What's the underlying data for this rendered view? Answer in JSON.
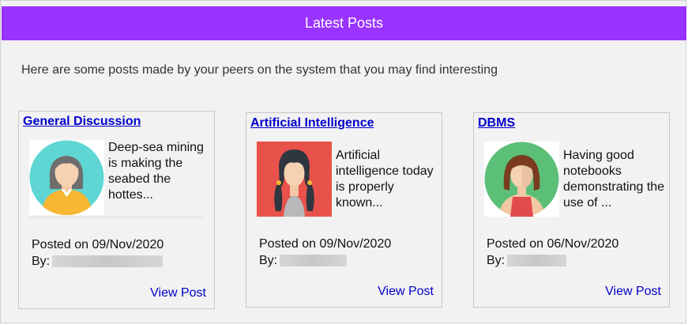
{
  "header": {
    "title": "Latest Posts"
  },
  "intro": "Here are some posts made by your peers on the system that you may find interesting",
  "posts": [
    {
      "category": "General Discussion",
      "excerpt": "Deep-sea mining is making the seabed the hottes...",
      "posted": "Posted on 09/Nov/2020",
      "by_label": "By:",
      "author": "[redacted]",
      "action": "View Post",
      "avatar_icon": "woman-avatar-icon",
      "avatar_bg": "#5fd6d3"
    },
    {
      "category": "Artificial Intelligence",
      "excerpt": "Artificial intelligence today is properly known...",
      "posted": "Posted on 09/Nov/2020",
      "by_label": "By:",
      "author": "[redacted]",
      "action": "View Post",
      "avatar_icon": "woman-avatar-icon",
      "avatar_bg": "#e8524a"
    },
    {
      "category": "DBMS",
      "excerpt": "Having good notebooks demonstrating the use of ...",
      "posted": "Posted on 06/Nov/2020",
      "by_label": "By:",
      "author": "[redacted]",
      "action": "View Post",
      "avatar_icon": "woman-avatar-icon",
      "avatar_bg": "#5cbf78"
    }
  ],
  "colors": {
    "header_bg": "#9933ff",
    "link": "#0000cc",
    "panel_bg": "#f2f2f2"
  }
}
